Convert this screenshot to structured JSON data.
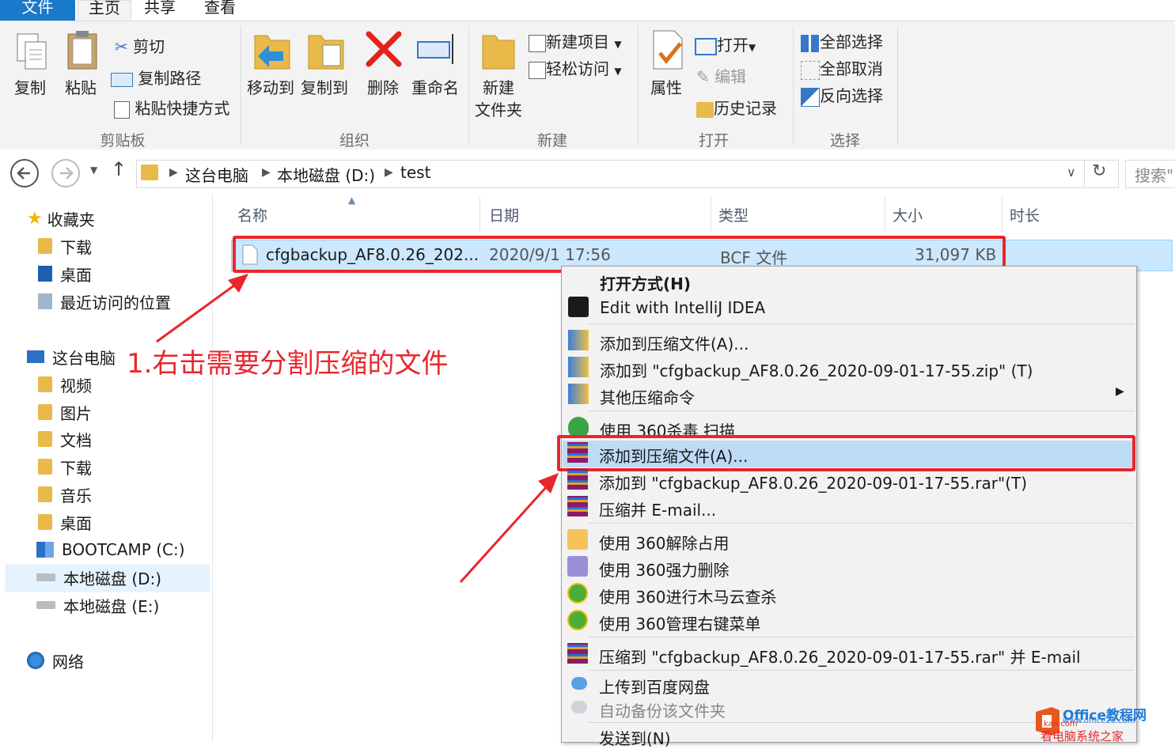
{
  "ribbon_tabs": {
    "file": "文件",
    "home": "主页",
    "share": "共享",
    "view": "查看"
  },
  "clipboard": {
    "copy": "复制",
    "paste": "粘贴",
    "cut": "剪切",
    "copy_path": "复制路径",
    "paste_shortcut": "粘贴快捷方式",
    "group": "剪贴板"
  },
  "organize": {
    "move_to": "移动到",
    "copy_to": "复制到",
    "delete": "删除",
    "rename": "重命名",
    "group": "组织"
  },
  "new": {
    "new_folder_1": "新建",
    "new_folder_2": "文件夹",
    "new_item": "新建项目",
    "easy_access": "轻松访问",
    "group": "新建"
  },
  "open": {
    "properties": "属性",
    "open": "打开",
    "edit": "编辑",
    "history": "历史记录",
    "group": "打开"
  },
  "select": {
    "select_all": "全部选择",
    "select_none": "全部取消",
    "invert": "反向选择",
    "group": "选择"
  },
  "address": {
    "pc": "这台电脑",
    "drive": "本地磁盘 (D:)",
    "folder": "test",
    "search_placeholder": "搜索\""
  },
  "nav": {
    "favorites": "收藏夹",
    "downloads": "下载",
    "desktop": "桌面",
    "recent": "最近访问的位置",
    "this_pc": "这台电脑",
    "videos": "视频",
    "pictures": "图片",
    "documents": "文档",
    "downloads2": "下载",
    "music": "音乐",
    "desktop2": "桌面",
    "bootcamp": "BOOTCAMP (C:)",
    "drive_d": "本地磁盘 (D:)",
    "drive_e": "本地磁盘 (E:)",
    "network": "网络"
  },
  "columns": {
    "name": "名称",
    "date": "日期",
    "type": "类型",
    "size": "大小",
    "duration": "时长"
  },
  "file": {
    "name": "cfgbackup_AF8.0.26_202...",
    "date": "2020/9/1 17:56",
    "type": "BCF 文件",
    "size": "31,097 KB"
  },
  "menu": {
    "open_with": "打开方式(H)",
    "intellij": "Edit with IntelliJ IDEA",
    "add_archive_1": "添加到压缩文件(A)...",
    "add_zip": "添加到 \"cfgbackup_AF8.0.26_2020-09-01-17-55.zip\" (T)",
    "other_compress": "其他压缩命令",
    "scan_360": "使用 360杀毒 扫描",
    "add_archive_2": "添加到压缩文件(A)...",
    "add_rar": "添加到 \"cfgbackup_AF8.0.26_2020-09-01-17-55.rar\"(T)",
    "compress_email": "压缩并 E-mail...",
    "unlock_360": "使用 360解除占用",
    "force_delete_360": "使用 360强力删除",
    "trojan_360": "使用 360进行木马云查杀",
    "manage_menu_360": "使用 360管理右键菜单",
    "compress_rar_email": "压缩到 \"cfgbackup_AF8.0.26_2020-09-01-17-55.rar\" 并 E-mail",
    "upload_baidu": "上传到百度网盘",
    "auto_backup": "自动备份该文件夹",
    "send_to": "发送到(N)"
  },
  "annotation": "1.右击需要分割压缩的文件",
  "watermark": {
    "brand": "Office教程网",
    "url": "www.office26.com",
    "site": "kan.com",
    "slogan": "看电脑系统之家"
  },
  "colors": {
    "accent": "#1979ca",
    "annotation_red": "#e8272c",
    "selection": "#cce8ff"
  }
}
